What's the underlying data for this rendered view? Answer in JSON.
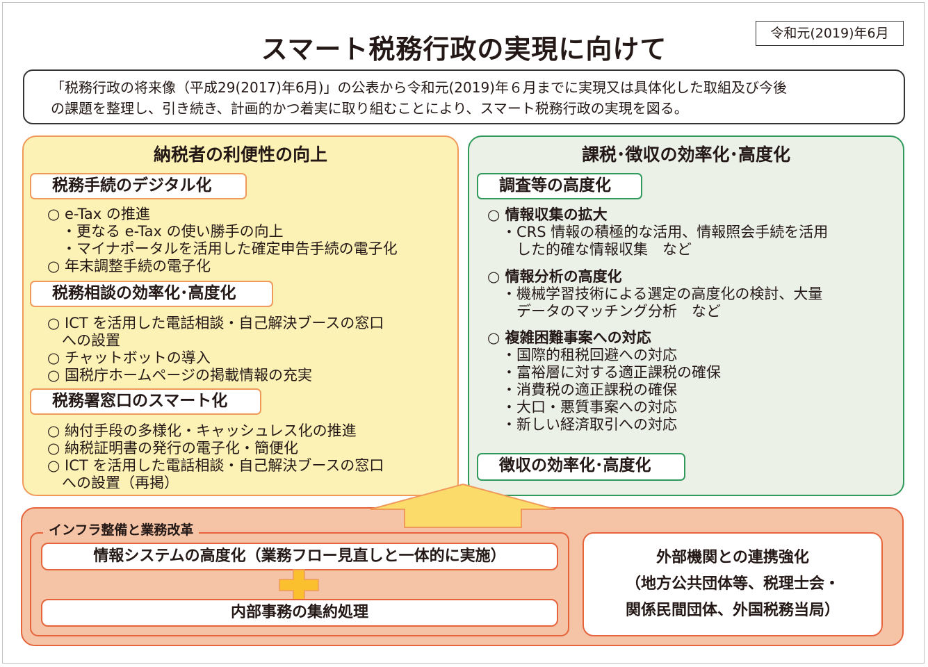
{
  "title": "スマート税務行政の実現に向けて",
  "date": "令和元(2019)年6月",
  "intro": [
    "「税務行政の将来像（平成29(2017)年6月)」の公表から令和元(2019)年６月までに実現又は具体化した取組及び今後",
    "の課題を整理し、引き続き、計画的かつ着実に取り組むことにより、スマート税務行政の実現を図る。"
  ],
  "left": {
    "heading": "納税者の利便性の向上",
    "sections": [
      {
        "tag": "税務手続のデジタル化",
        "lines": [
          "○ e-Tax の推進",
          "　・更なる e-Tax の使い勝手の向上",
          "　・マイナポータルを活用した確定申告手続の電子化",
          "○ 年末調整手続の電子化"
        ]
      },
      {
        "tag": "税務相談の効率化･高度化",
        "lines": [
          "○ ICT を活用した電話相談・自己解決ブースの窓口",
          "　への設置",
          "○ チャットボットの導入",
          "○ 国税庁ホームページの掲載情報の充実"
        ]
      },
      {
        "tag": "税務署窓口のスマート化",
        "lines": [
          "○ 納付手段の多様化・キャッシュレス化の推進",
          "○ 納税証明書の発行の電子化・簡便化",
          "○ ICT を活用した電話相談・自己解決ブースの窓口",
          "　への設置（再掲）"
        ]
      }
    ]
  },
  "right": {
    "heading": "課税･徴収の効率化･高度化",
    "tag1": "調査等の高度化",
    "items": [
      {
        "head": "○ 情報収集の拡大",
        "lines": [
          "　・CRS 情報の積極的な活用、情報照会手続を活用",
          "　　した的確な情報収集　など"
        ]
      },
      {
        "head": "○ 情報分析の高度化",
        "lines": [
          "　・機械学習技術による選定の高度化の検討、大量",
          "　　データのマッチング分析　など"
        ]
      },
      {
        "head": "○ 複雑困難事案への対応",
        "lines": [
          "　・国際的租税回避への対応",
          "　・富裕層に対する適正課税の確保",
          "　・消費税の適正課税の確保",
          "　・大口・悪質事案への対応",
          "　・新しい経済取引への対応"
        ]
      }
    ],
    "tag2": "徴収の効率化･高度化"
  },
  "infra": {
    "label": "インフラ整備と業務改革",
    "box1": "情報システムの高度化（業務フロー見直しと一体的に実施）",
    "box2": "内部事務の集約処理",
    "external": [
      "外部機関との連携強化",
      "（地方公共団体等、税理士会・",
      "関係民間団体、外国税務当局）"
    ]
  },
  "colors": {
    "left_fill": "#fdf2b6",
    "left_border": "#ef9a5a",
    "right_fill": "#ebf1e6",
    "right_border": "#2f9a5b",
    "infra_fill": "#f5c3a6",
    "infra_border": "#e5643c",
    "arrow_fill": "#fbdc6a",
    "plus_fill": "#fbc02d"
  },
  "icons": {
    "arrow": "up-arrow-icon",
    "plus": "plus-icon"
  }
}
